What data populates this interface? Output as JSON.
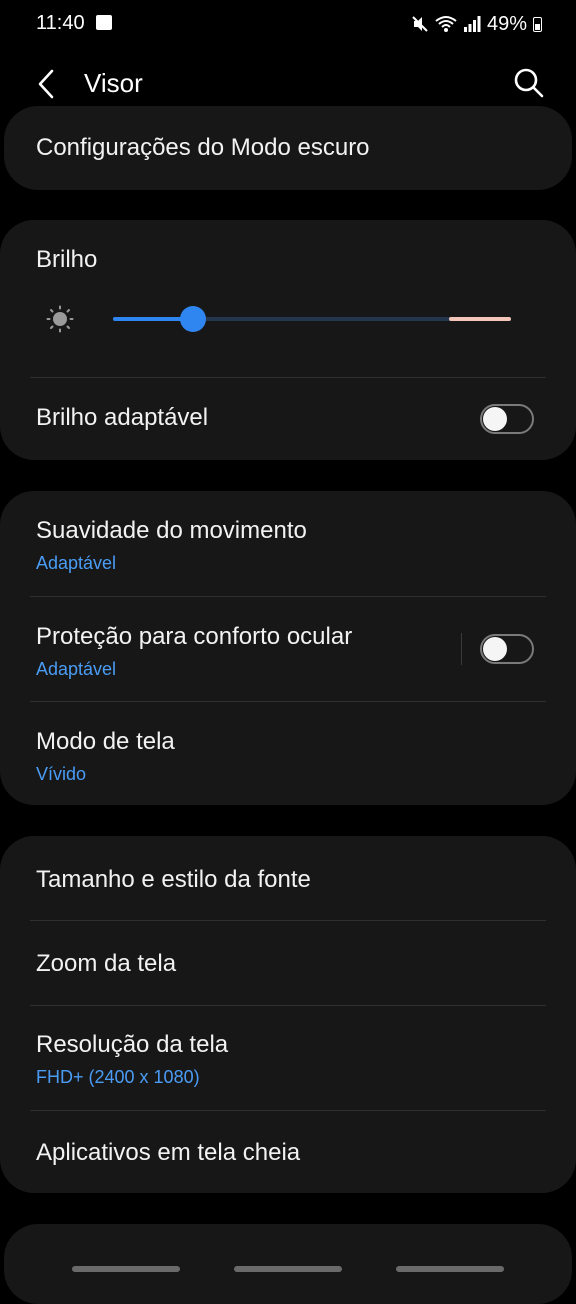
{
  "status_bar": {
    "time": "11:40",
    "battery": "49%"
  },
  "header": {
    "title": "Visor"
  },
  "cards": {
    "dark_mode": {
      "title": "Configurações do Modo escuro"
    },
    "brightness": {
      "title": "Brilho",
      "slider_level_percent": 20,
      "adaptive_title": "Brilho adaptável",
      "adaptive_on": false
    },
    "motion": {
      "smoothness_title": "Suavidade do movimento",
      "smoothness_value": "Adaptável",
      "eye_title": "Proteção para conforto ocular",
      "eye_value": "Adaptável",
      "eye_on": false,
      "screen_mode_title": "Modo de tela",
      "screen_mode_value": "Vívido"
    },
    "font": {
      "font_title": "Tamanho e estilo da fonte",
      "zoom_title": "Zoom da tela",
      "resolution_title": "Resolução da tela",
      "resolution_value": "FHD+ (2400 x 1080)",
      "fullscreen_title": "Aplicativos em tela cheia"
    }
  },
  "colors": {
    "accent": "#4a9cf5",
    "slider": "#2f86f0",
    "card": "#171717",
    "background": "#000000"
  },
  "icons": [
    "back-arrow-icon",
    "search-icon",
    "sun-icon",
    "gallery-icon",
    "mute-icon",
    "wifi-icon",
    "signal-icon",
    "battery-icon"
  ]
}
